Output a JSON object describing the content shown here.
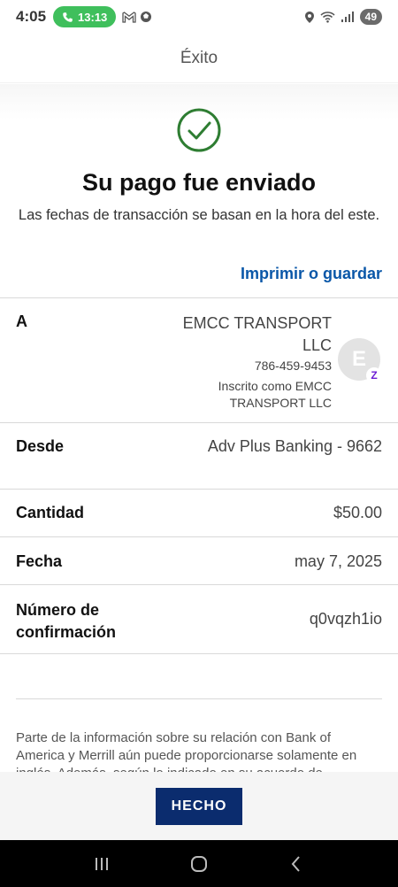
{
  "status_bar": {
    "time": "4:05",
    "call_duration": "13:13",
    "battery": "49",
    "icons": [
      "phone-icon",
      "gmail-icon",
      "ball-icon",
      "location-icon",
      "wifi-icon",
      "signal-icon",
      "battery-icon"
    ]
  },
  "header": {
    "title": "Éxito"
  },
  "success": {
    "icon": "check-circle-icon",
    "title": "Su pago fue enviado",
    "subtitle": "Las fechas de transacción se basan en la hora del este.",
    "print_link": "Imprimir o guardar"
  },
  "details": {
    "to_label": "A",
    "recipient_name": "EMCC TRANSPORT LLC",
    "recipient_phone": "786-459-9453",
    "recipient_enrolled": "Inscrito como EMCC TRANSPORT LLC",
    "avatar_initial": "E",
    "zelle_badge": "Z",
    "from_label": "Desde",
    "from_value": "Adv Plus Banking - 9662",
    "amount_label": "Cantidad",
    "amount_value": "$50.00",
    "date_label": "Fecha",
    "date_value": "may 7, 2025",
    "confirmation_label": "Número de confirmación",
    "confirmation_value": "q0vqzh1io"
  },
  "disclaimer": "Parte de la información sobre su relación con Bank of America y Merrill aún puede proporcionarse solamente en inglés. Además, según lo indicado en su acuerdo de",
  "footer": {
    "done_label": "HECHO"
  },
  "colors": {
    "link": "#0a57a8",
    "success_green": "#2e7d32",
    "button_navy": "#0b2c6e",
    "zelle_purple": "#6d1ed4"
  }
}
